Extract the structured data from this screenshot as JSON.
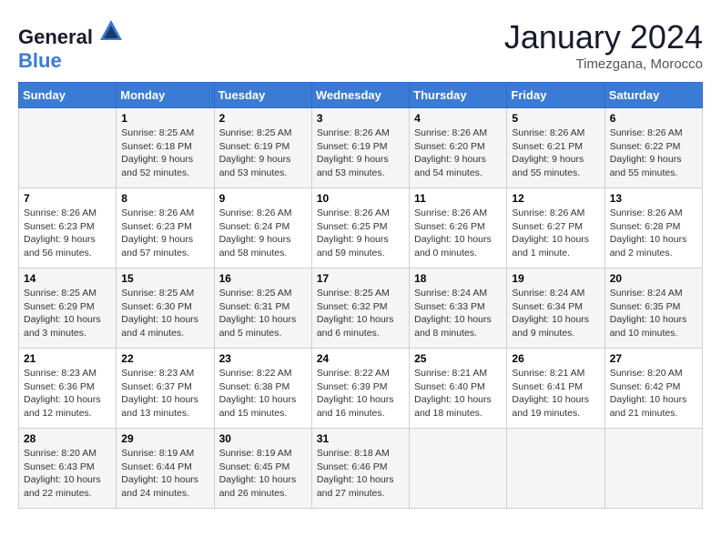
{
  "header": {
    "logo_general": "General",
    "logo_blue": "Blue",
    "month_title": "January 2024",
    "location": "Timezgana, Morocco"
  },
  "days_of_week": [
    "Sunday",
    "Monday",
    "Tuesday",
    "Wednesday",
    "Thursday",
    "Friday",
    "Saturday"
  ],
  "weeks": [
    [
      {
        "day": "",
        "content": ""
      },
      {
        "day": "1",
        "content": "Sunrise: 8:25 AM\nSunset: 6:18 PM\nDaylight: 9 hours\nand 52 minutes."
      },
      {
        "day": "2",
        "content": "Sunrise: 8:25 AM\nSunset: 6:19 PM\nDaylight: 9 hours\nand 53 minutes."
      },
      {
        "day": "3",
        "content": "Sunrise: 8:26 AM\nSunset: 6:19 PM\nDaylight: 9 hours\nand 53 minutes."
      },
      {
        "day": "4",
        "content": "Sunrise: 8:26 AM\nSunset: 6:20 PM\nDaylight: 9 hours\nand 54 minutes."
      },
      {
        "day": "5",
        "content": "Sunrise: 8:26 AM\nSunset: 6:21 PM\nDaylight: 9 hours\nand 55 minutes."
      },
      {
        "day": "6",
        "content": "Sunrise: 8:26 AM\nSunset: 6:22 PM\nDaylight: 9 hours\nand 55 minutes."
      }
    ],
    [
      {
        "day": "7",
        "content": "Sunrise: 8:26 AM\nSunset: 6:23 PM\nDaylight: 9 hours\nand 56 minutes."
      },
      {
        "day": "8",
        "content": "Sunrise: 8:26 AM\nSunset: 6:23 PM\nDaylight: 9 hours\nand 57 minutes."
      },
      {
        "day": "9",
        "content": "Sunrise: 8:26 AM\nSunset: 6:24 PM\nDaylight: 9 hours\nand 58 minutes."
      },
      {
        "day": "10",
        "content": "Sunrise: 8:26 AM\nSunset: 6:25 PM\nDaylight: 9 hours\nand 59 minutes."
      },
      {
        "day": "11",
        "content": "Sunrise: 8:26 AM\nSunset: 6:26 PM\nDaylight: 10 hours\nand 0 minutes."
      },
      {
        "day": "12",
        "content": "Sunrise: 8:26 AM\nSunset: 6:27 PM\nDaylight: 10 hours\nand 1 minute."
      },
      {
        "day": "13",
        "content": "Sunrise: 8:26 AM\nSunset: 6:28 PM\nDaylight: 10 hours\nand 2 minutes."
      }
    ],
    [
      {
        "day": "14",
        "content": "Sunrise: 8:25 AM\nSunset: 6:29 PM\nDaylight: 10 hours\nand 3 minutes."
      },
      {
        "day": "15",
        "content": "Sunrise: 8:25 AM\nSunset: 6:30 PM\nDaylight: 10 hours\nand 4 minutes."
      },
      {
        "day": "16",
        "content": "Sunrise: 8:25 AM\nSunset: 6:31 PM\nDaylight: 10 hours\nand 5 minutes."
      },
      {
        "day": "17",
        "content": "Sunrise: 8:25 AM\nSunset: 6:32 PM\nDaylight: 10 hours\nand 6 minutes."
      },
      {
        "day": "18",
        "content": "Sunrise: 8:24 AM\nSunset: 6:33 PM\nDaylight: 10 hours\nand 8 minutes."
      },
      {
        "day": "19",
        "content": "Sunrise: 8:24 AM\nSunset: 6:34 PM\nDaylight: 10 hours\nand 9 minutes."
      },
      {
        "day": "20",
        "content": "Sunrise: 8:24 AM\nSunset: 6:35 PM\nDaylight: 10 hours\nand 10 minutes."
      }
    ],
    [
      {
        "day": "21",
        "content": "Sunrise: 8:23 AM\nSunset: 6:36 PM\nDaylight: 10 hours\nand 12 minutes."
      },
      {
        "day": "22",
        "content": "Sunrise: 8:23 AM\nSunset: 6:37 PM\nDaylight: 10 hours\nand 13 minutes."
      },
      {
        "day": "23",
        "content": "Sunrise: 8:22 AM\nSunset: 6:38 PM\nDaylight: 10 hours\nand 15 minutes."
      },
      {
        "day": "24",
        "content": "Sunrise: 8:22 AM\nSunset: 6:39 PM\nDaylight: 10 hours\nand 16 minutes."
      },
      {
        "day": "25",
        "content": "Sunrise: 8:21 AM\nSunset: 6:40 PM\nDaylight: 10 hours\nand 18 minutes."
      },
      {
        "day": "26",
        "content": "Sunrise: 8:21 AM\nSunset: 6:41 PM\nDaylight: 10 hours\nand 19 minutes."
      },
      {
        "day": "27",
        "content": "Sunrise: 8:20 AM\nSunset: 6:42 PM\nDaylight: 10 hours\nand 21 minutes."
      }
    ],
    [
      {
        "day": "28",
        "content": "Sunrise: 8:20 AM\nSunset: 6:43 PM\nDaylight: 10 hours\nand 22 minutes."
      },
      {
        "day": "29",
        "content": "Sunrise: 8:19 AM\nSunset: 6:44 PM\nDaylight: 10 hours\nand 24 minutes."
      },
      {
        "day": "30",
        "content": "Sunrise: 8:19 AM\nSunset: 6:45 PM\nDaylight: 10 hours\nand 26 minutes."
      },
      {
        "day": "31",
        "content": "Sunrise: 8:18 AM\nSunset: 6:46 PM\nDaylight: 10 hours\nand 27 minutes."
      },
      {
        "day": "",
        "content": ""
      },
      {
        "day": "",
        "content": ""
      },
      {
        "day": "",
        "content": ""
      }
    ]
  ]
}
